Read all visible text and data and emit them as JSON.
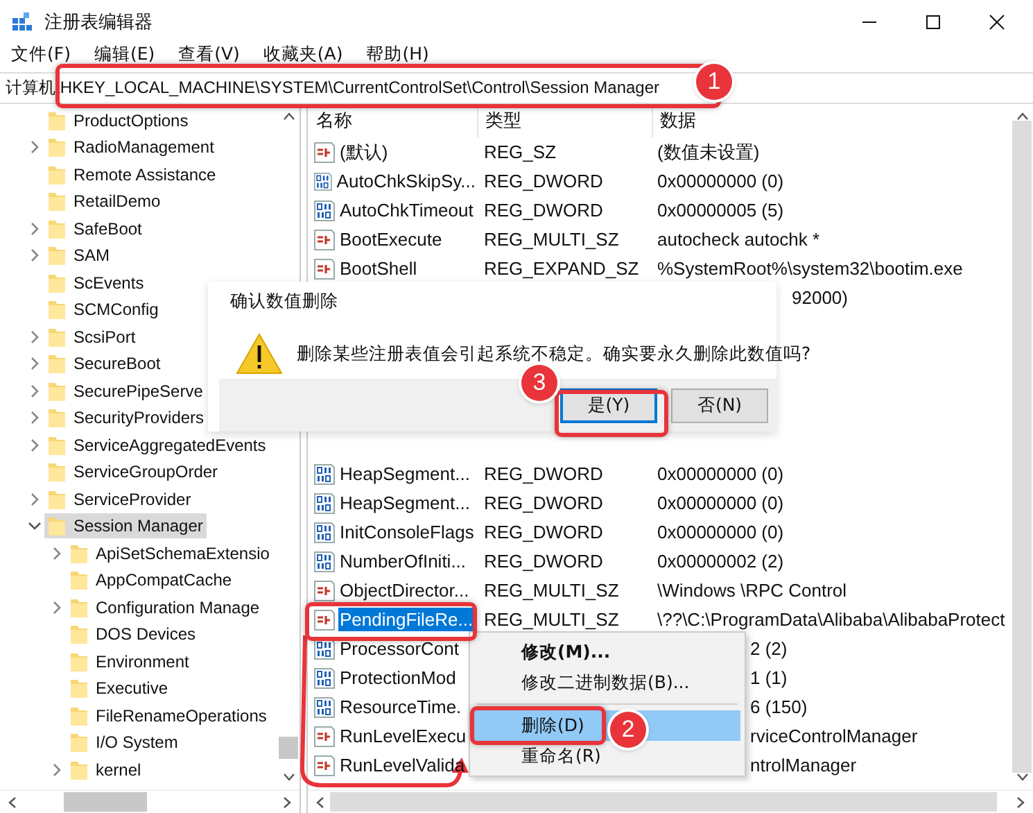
{
  "window": {
    "title": "注册表编辑器"
  },
  "menu": [
    "文件(F)",
    "编辑(E)",
    "查看(V)",
    "收藏夹(A)",
    "帮助(H)"
  ],
  "address": "计算机\\HKEY_LOCAL_MACHINE\\SYSTEM\\CurrentControlSet\\Control\\Session Manager",
  "tree": {
    "items": [
      {
        "label": "ProductOptions",
        "selected": false
      },
      {
        "label": "RadioManagement",
        "expanded": false,
        "selected": false
      },
      {
        "label": "Remote Assistance",
        "selected": false
      },
      {
        "label": "RetailDemo",
        "selected": false
      },
      {
        "label": "SafeBoot",
        "expanded": false,
        "selected": false
      },
      {
        "label": "SAM",
        "expanded": false,
        "selected": false
      },
      {
        "label": "ScEvents",
        "selected": false
      },
      {
        "label": "SCMConfig",
        "selected": false
      },
      {
        "label": "ScsiPort",
        "expanded": false,
        "selected": false
      },
      {
        "label": "SecureBoot",
        "expanded": false,
        "selected": false
      },
      {
        "label": "SecurePipeServe",
        "expanded": false,
        "selected": false
      },
      {
        "label": "SecurityProviders",
        "expanded": false,
        "selected": false
      },
      {
        "label": "ServiceAggregatedEvents",
        "expanded": false,
        "selected": false
      },
      {
        "label": "ServiceGroupOrder",
        "selected": false
      },
      {
        "label": "ServiceProvider",
        "expanded": false,
        "selected": false
      },
      {
        "label": "Session Manager",
        "expanded": true,
        "selected": true,
        "children": [
          {
            "label": "ApiSetSchemaExtensio",
            "expanded": false,
            "selected": false
          },
          {
            "label": "AppCompatCache",
            "selected": false
          },
          {
            "label": "Configuration Manage",
            "expanded": false,
            "selected": false
          },
          {
            "label": "DOS Devices",
            "selected": false
          },
          {
            "label": "Environment",
            "selected": false
          },
          {
            "label": "Executive",
            "selected": false
          },
          {
            "label": "FileRenameOperations",
            "selected": false
          },
          {
            "label": "I/O System",
            "selected": false
          },
          {
            "label": "kernel",
            "expanded": false,
            "selected": false
          }
        ]
      }
    ]
  },
  "list": {
    "columns": [
      "名称",
      "类型",
      "数据"
    ],
    "rows_upper": [
      {
        "name": "(默认)",
        "type": "REG_SZ",
        "data": "(数值未设置)",
        "kind": "string",
        "selected": false
      },
      {
        "name": "AutoChkSkipSy...",
        "type": "REG_DWORD",
        "data": "0x00000000 (0)",
        "kind": "binary",
        "selected": false
      },
      {
        "name": "AutoChkTimeout",
        "type": "REG_DWORD",
        "data": "0x00000005 (5)",
        "kind": "binary",
        "selected": false
      },
      {
        "name": "BootExecute",
        "type": "REG_MULTI_SZ",
        "data": "autocheck autochk *",
        "kind": "string",
        "selected": false
      },
      {
        "name": "BootShell",
        "type": "REG_EXPAND_SZ",
        "data": "%SystemRoot%\\system32\\bootim.exe",
        "kind": "string",
        "selected": false
      },
      {
        "data": "92000)",
        "selected": false
      }
    ],
    "rows_lower": [
      {
        "name": "HeapSegment...",
        "type": "REG_DWORD",
        "data": "0x00000000 (0)",
        "kind": "binary",
        "selected": false
      },
      {
        "name": "HeapSegment...",
        "type": "REG_DWORD",
        "data": "0x00000000 (0)",
        "kind": "binary",
        "selected": false
      },
      {
        "name": "InitConsoleFlags",
        "type": "REG_DWORD",
        "data": "0x00000000 (0)",
        "kind": "binary",
        "selected": false
      },
      {
        "name": "NumberOfIniti...",
        "type": "REG_DWORD",
        "data": "0x00000002 (2)",
        "kind": "binary",
        "selected": false
      },
      {
        "name": "ObjectDirector...",
        "type": "REG_MULTI_SZ",
        "data": "\\Windows \\RPC Control",
        "kind": "string",
        "selected": false
      },
      {
        "name": "PendingFileRe...",
        "type": "REG_MULTI_SZ",
        "data": "\\??\\C:\\ProgramData\\Alibaba\\AlibabaProtect",
        "kind": "string",
        "selected": true
      },
      {
        "name": "ProcessorCont",
        "data": "2 (2)",
        "kind": "binary",
        "selected": false
      },
      {
        "name": "ProtectionMod",
        "data": "1 (1)",
        "kind": "binary",
        "selected": false
      },
      {
        "name": "ResourceTime.",
        "data": "6 (150)",
        "kind": "binary",
        "selected": false
      },
      {
        "name": "RunLevelExecu",
        "data": "rviceControlManager",
        "kind": "string",
        "selected": false
      },
      {
        "name": "RunLevelValida",
        "data": "ntrolManager",
        "kind": "string",
        "selected": false
      }
    ]
  },
  "dialog": {
    "title": "确认数值删除",
    "message": "删除某些注册表值会引起系统不稳定。确实要永久删除此数值吗?",
    "buttons": [
      {
        "label": "是(Y)",
        "selected": true
      },
      {
        "label": "否(N)",
        "selected": false
      }
    ]
  },
  "context_menu": {
    "items": [
      {
        "label": "修改(M)...",
        "default": true,
        "selected": false,
        "separator_before": false
      },
      {
        "label": "修改二进制数据(B)...",
        "default": false,
        "selected": false,
        "separator_before": false
      },
      {
        "label": "删除(D)",
        "default": false,
        "selected": true,
        "separator_before": true
      },
      {
        "label": "重命名(R)",
        "default": false,
        "selected": false,
        "separator_before": false
      }
    ]
  },
  "annotations": [
    {
      "number": "1"
    },
    {
      "number": "2"
    },
    {
      "number": "3"
    }
  ]
}
